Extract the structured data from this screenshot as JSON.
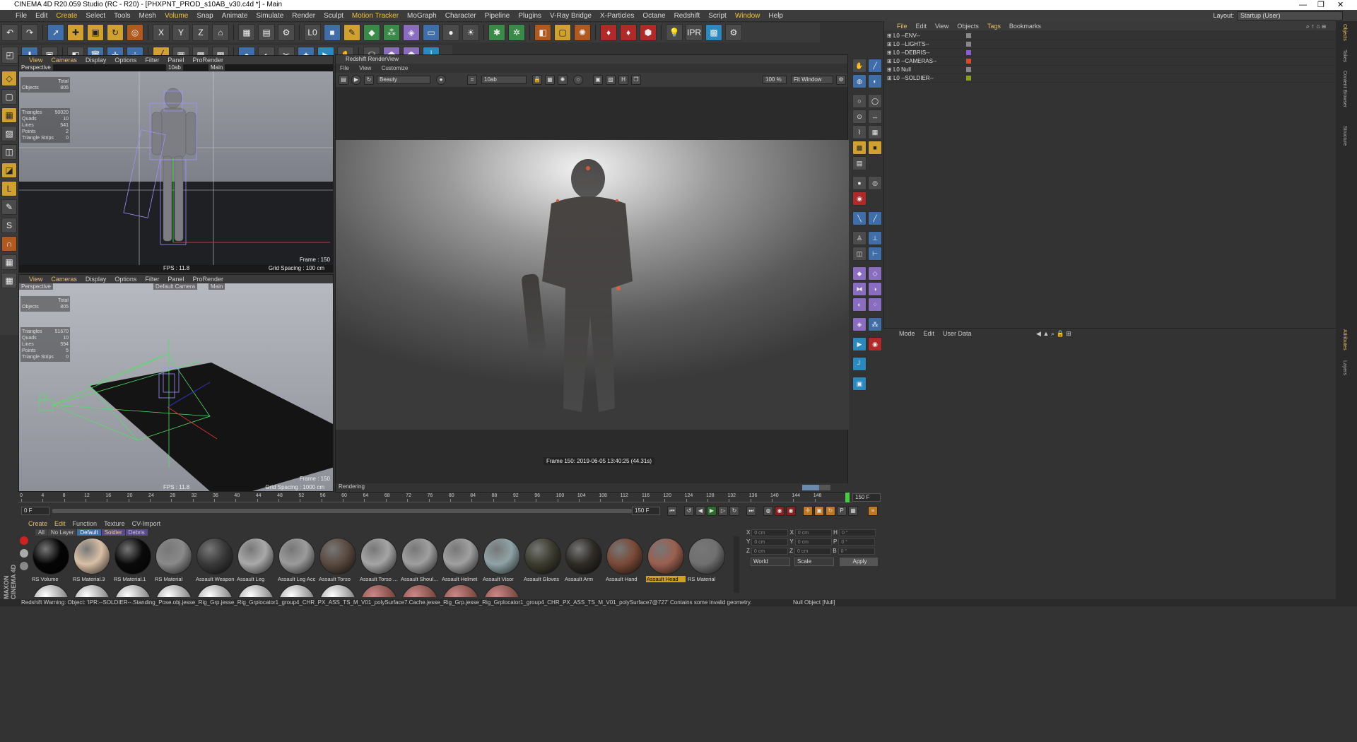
{
  "window": {
    "title": "CINEMA 4D R20.059 Studio (RC - R20) - [PHXPNT_PROD_s10AB_v30.c4d *] - Main"
  },
  "menus": [
    "File",
    "Edit",
    "Create",
    "Select",
    "Tools",
    "Mesh",
    "Volume",
    "Snap",
    "Animate",
    "Simulate",
    "Render",
    "Sculpt",
    "Motion Tracker",
    "MoGraph",
    "Character",
    "Pipeline",
    "Plugins",
    "V-Ray Bridge",
    "X-Particles",
    "Octane",
    "Redshift",
    "Script",
    "Window",
    "Help"
  ],
  "layout": {
    "label": "Layout:",
    "value": "Startup (User)"
  },
  "viewport_menu": [
    "View",
    "Cameras",
    "Display",
    "Options",
    "Filter",
    "Panel",
    "ProRender"
  ],
  "viewport1": {
    "label": "Perspective",
    "camera": "10ab",
    "take": "Main",
    "stats": {
      "total": "Total",
      "objects_label": "Objects",
      "objects": "805",
      "tri_label": "Triangles",
      "tri": "50020",
      "quads_label": "Quads",
      "quads": "10",
      "lines_label": "Lines",
      "lines": "541",
      "points_label": "Points",
      "points": "2",
      "strips_label": "Triangle Strips",
      "strips": "0"
    },
    "frame": "Frame : 150",
    "fps": "FPS : 11.8",
    "grid": "Grid Spacing : 100 cm"
  },
  "viewport2": {
    "label": "Perspective",
    "camera": "Default Camera",
    "take": "Main",
    "stats": {
      "total": "Total",
      "objects_label": "Objects",
      "objects": "805",
      "tri_label": "Triangles",
      "tri": "51670",
      "quads_label": "Quads",
      "quads": "10",
      "lines_label": "Lines",
      "lines": "594",
      "points_label": "Points",
      "points": "5",
      "strips_label": "Triangle Strips",
      "strips": "0"
    },
    "frame": "Frame : 150",
    "fps": "FPS : 11.8",
    "grid": "Grid Spacing : 1000 cm"
  },
  "renderview": {
    "title": "Redshift RenderView",
    "menu": [
      "File",
      "View",
      "Customize"
    ],
    "aov": "Beauty",
    "camera": "10ab",
    "zoom": "100 %",
    "fit": "Fit Window",
    "frame_info": "Frame  150:  2019-06-05  13:40:25  (44.31s)",
    "status": "Rendering"
  },
  "timeline": {
    "ticks": [
      "0",
      "4",
      "8",
      "12",
      "16",
      "20",
      "24",
      "28",
      "32",
      "36",
      "40",
      "44",
      "48",
      "52",
      "56",
      "60",
      "64",
      "68",
      "72",
      "76",
      "80",
      "84",
      "88",
      "92",
      "96",
      "100",
      "104",
      "108",
      "112",
      "116",
      "120",
      "124",
      "128",
      "132",
      "136",
      "140",
      "144",
      "148"
    ],
    "current": "150 F",
    "start": "0 F",
    "end": "150 F",
    "end2": "150 F"
  },
  "materials": {
    "menu": [
      "Create",
      "Edit",
      "Function",
      "Texture",
      "CV-Import"
    ],
    "filters": [
      "All",
      "No Layer",
      "Default",
      "Soldier",
      "Debris"
    ],
    "items": [
      {
        "name": "RS Volume",
        "color": "#050505"
      },
      {
        "name": "RS Material.3",
        "color": "#d9bfa6"
      },
      {
        "name": "RS Material.1",
        "color": "#0a0a0a"
      },
      {
        "name": "RS Material",
        "color": "#8a8a8a"
      },
      {
        "name": "Assault Weapon",
        "color": "#3a3a3a"
      },
      {
        "name": "Assault Leg",
        "color": "#a9a9a9"
      },
      {
        "name": "Assault Leg Acc",
        "color": "#9b9b9b"
      },
      {
        "name": "Assault Torso",
        "color": "#5a4a40"
      },
      {
        "name": "Assault Torso Acc",
        "color": "#a5a5a5"
      },
      {
        "name": "Assault Shoulder",
        "color": "#9f9f9f"
      },
      {
        "name": "Assault Helmet",
        "color": "#a0a0a0"
      },
      {
        "name": "Assault Visor",
        "color": "#8fa3a6"
      },
      {
        "name": "Assault Gloves",
        "color": "#3c3c30"
      },
      {
        "name": "Assault Arm",
        "color": "#2f2c26"
      },
      {
        "name": "Assault Hand",
        "color": "#7a4a38"
      },
      {
        "name": "Assault Head",
        "color": "#9a6050"
      },
      {
        "name": "RS Material",
        "color": "#707070"
      }
    ],
    "active": "Assault Head"
  },
  "coords": {
    "rows": [
      [
        "X",
        "0 cm",
        "X",
        "0 cm",
        "H",
        "0 °"
      ],
      [
        "Y",
        "0 cm",
        "Y",
        "0 cm",
        "P",
        "0 °"
      ],
      [
        "Z",
        "0 cm",
        "Z",
        "0 cm",
        "B",
        "0 °"
      ]
    ],
    "space": "World",
    "mode": "Scale",
    "apply": "Apply"
  },
  "objects": {
    "menu": [
      "File",
      "Edit",
      "View",
      "Objects",
      "Tags",
      "Bookmarks"
    ],
    "items": [
      {
        "name": "--ENV--",
        "color": "#888888"
      },
      {
        "name": "--LIGHTS--",
        "color": "#888888"
      },
      {
        "name": "--DEBRIS--",
        "color": "#8a5cd8"
      },
      {
        "name": "--CAMERAS--",
        "color": "#d84a2a"
      },
      {
        "name": "Null",
        "color": "#888888"
      },
      {
        "name": "--SOLDIER--",
        "color": "#8aa020"
      }
    ]
  },
  "attributes": {
    "menu": [
      "Mode",
      "Edit",
      "User Data"
    ]
  },
  "side_tabs": [
    "Objects",
    "Takes",
    "Content Browser",
    "Structure",
    "Attributes",
    "Layers"
  ],
  "status": {
    "message": "Redshift Warning: Object: 'IPR:--SOLDIER--.Standing_Pose.obj.jesse_Rig_Grp.jesse_Rig_Grplocator1_group4_CHR_PX_ASS_TS_M_V01_polySurface7.Cache.jesse_Rig_Grp.jesse_Rig_Grplocator1_group4_CHR_PX_ASS_TS_M_V01_polySurface7@727' Contains some invalid geometry.",
    "selection": "Null Object [Null]"
  },
  "brand": "MAXON CINEMA 4D",
  "ipr_label": "IPR"
}
